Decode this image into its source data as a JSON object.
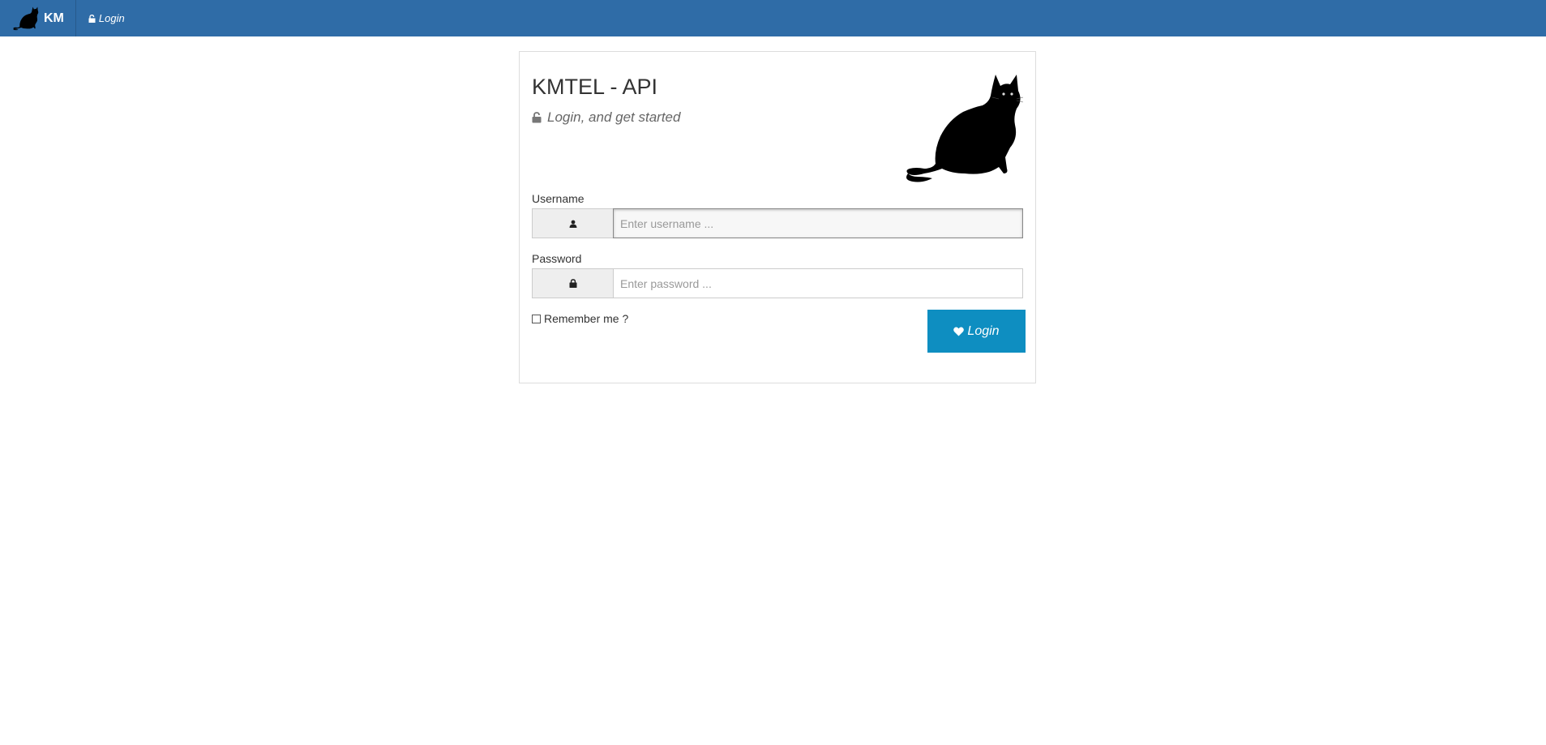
{
  "navbar": {
    "brand_text": "KM",
    "brand_logo_icon": "black-cat-icon",
    "login_link": "Login",
    "login_link_icon": "unlock-icon",
    "background_color": "#2f6ca7"
  },
  "panel": {
    "title": "KMTEL - API",
    "subtitle": "Login, and get started",
    "subtitle_icon": "unlock-icon",
    "image": "black-cat-icon"
  },
  "form": {
    "username": {
      "label": "Username",
      "placeholder": "Enter username ...",
      "value": "",
      "icon": "user-icon"
    },
    "password": {
      "label": "Password",
      "placeholder": "Enter password ...",
      "value": "",
      "icon": "lock-icon"
    },
    "remember_label": "Remember me ?",
    "remember_checked": false,
    "submit_label": "Login",
    "submit_icon": "heart-icon",
    "submit_color": "#0e8ec1"
  }
}
